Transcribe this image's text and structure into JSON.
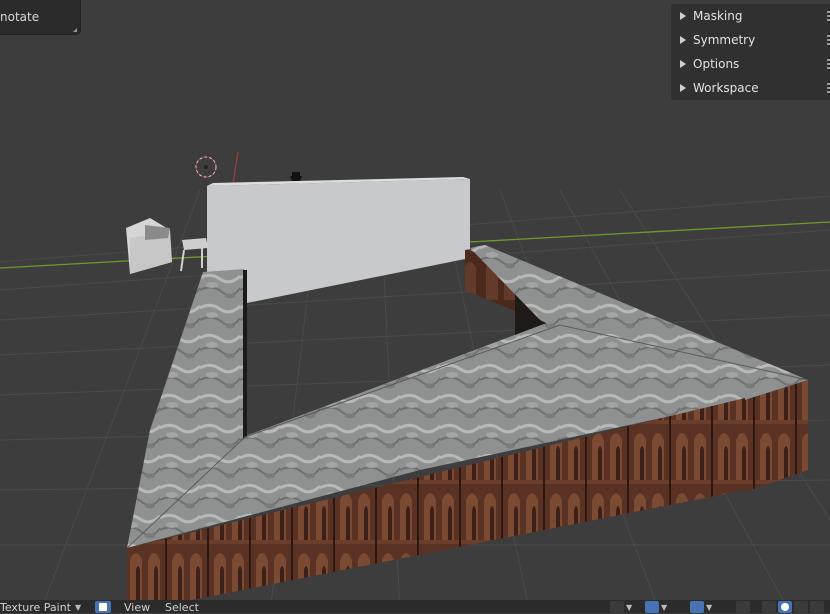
{
  "last_operator": {
    "label": "notate"
  },
  "tool_panel": {
    "sections": [
      {
        "label": "Masking"
      },
      {
        "label": "Symmetry"
      },
      {
        "label": "Options"
      },
      {
        "label": "Workspace"
      }
    ]
  },
  "header": {
    "mode_label": "Texture Paint",
    "menus": [
      "View",
      "Select"
    ]
  },
  "icons": {
    "mode_caret": "chevron-down-icon",
    "texture_slot": "texture-slot-icon",
    "visibility": "eye-icon",
    "gizmo": "gizmo-icon",
    "overlays": "overlays-icon",
    "xray": "xray-icon",
    "shading_wire": "wireframe-shading-icon",
    "shading_solid": "solid-shading-icon",
    "shading_material": "material-shading-icon",
    "shading_rendered": "rendered-shading-icon"
  },
  "colors": {
    "viewport_bg": "#3d3d3d",
    "panel_bg": "#303030",
    "header_bg": "#2b2b2b",
    "accent_blue": "#4772b3",
    "axis_green": "#6a9a2e",
    "axis_red": "#9a3b3b"
  }
}
